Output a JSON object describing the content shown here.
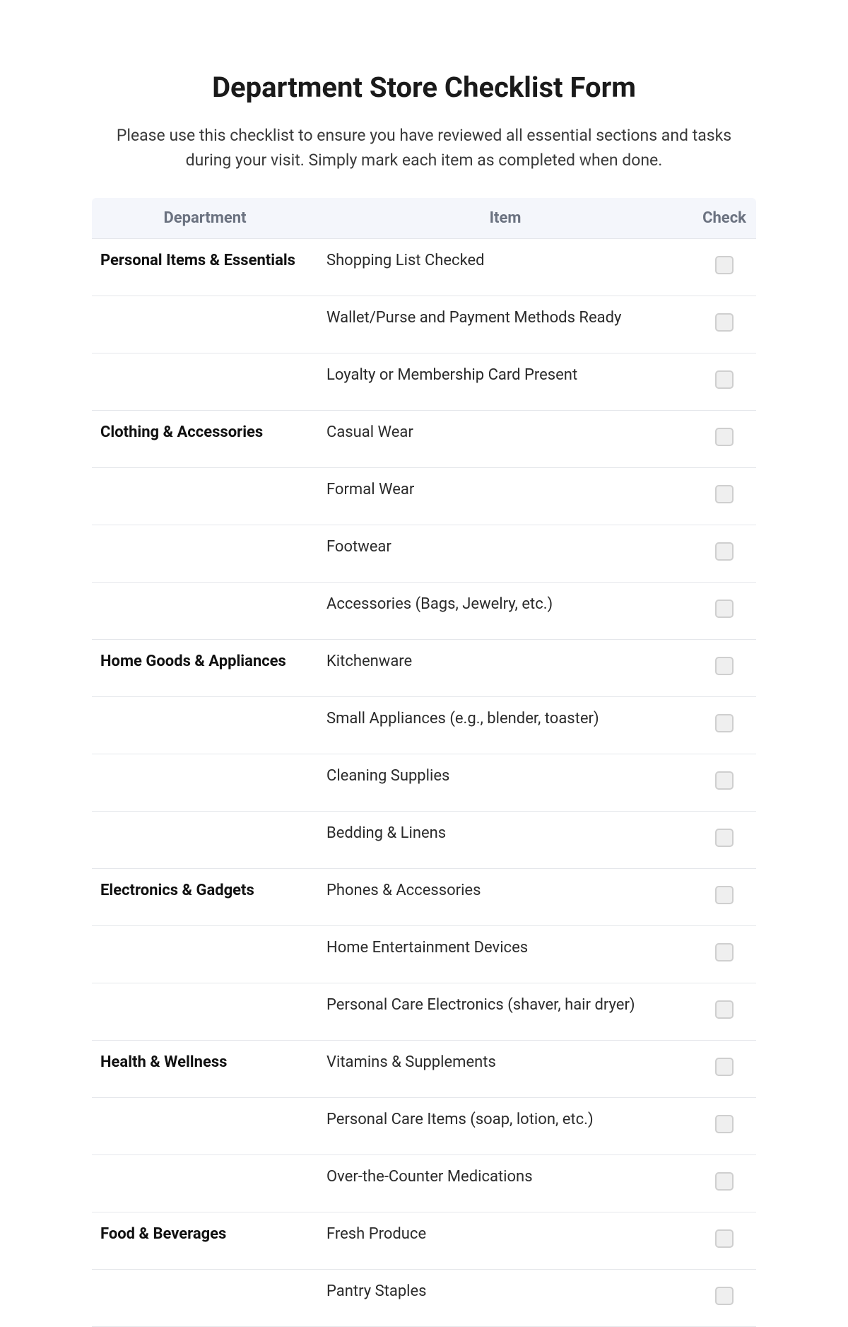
{
  "title": "Department Store Checklist Form",
  "intro": "Please use this checklist to ensure you have reviewed all essential sections and tasks during your visit. Simply mark each item as completed when done.",
  "table": {
    "headers": {
      "department": "Department",
      "item": "Item",
      "check": "Check"
    },
    "rows": [
      {
        "department": "Personal Items & Essentials",
        "item": "Shopping List Checked"
      },
      {
        "department": "",
        "item": "Wallet/Purse and Payment Methods Ready"
      },
      {
        "department": "",
        "item": "Loyalty or Membership Card Present"
      },
      {
        "department": "Clothing & Accessories",
        "item": "Casual Wear"
      },
      {
        "department": "",
        "item": "Formal Wear"
      },
      {
        "department": "",
        "item": "Footwear"
      },
      {
        "department": "",
        "item": "Accessories (Bags, Jewelry, etc.)"
      },
      {
        "department": "Home Goods & Appliances",
        "item": "Kitchenware"
      },
      {
        "department": "",
        "item": "Small Appliances (e.g., blender, toaster)"
      },
      {
        "department": "",
        "item": "Cleaning Supplies"
      },
      {
        "department": "",
        "item": "Bedding & Linens"
      },
      {
        "department": "Electronics & Gadgets",
        "item": "Phones & Accessories"
      },
      {
        "department": "",
        "item": "Home Entertainment Devices"
      },
      {
        "department": "",
        "item": "Personal Care Electronics (shaver, hair dryer)"
      },
      {
        "department": "Health & Wellness",
        "item": "Vitamins & Supplements"
      },
      {
        "department": "",
        "item": "Personal Care Items (soap, lotion, etc.)"
      },
      {
        "department": "",
        "item": "Over-the-Counter Medications"
      },
      {
        "department": "Food & Beverages",
        "item": "Fresh Produce"
      },
      {
        "department": "",
        "item": "Pantry Staples"
      }
    ]
  }
}
